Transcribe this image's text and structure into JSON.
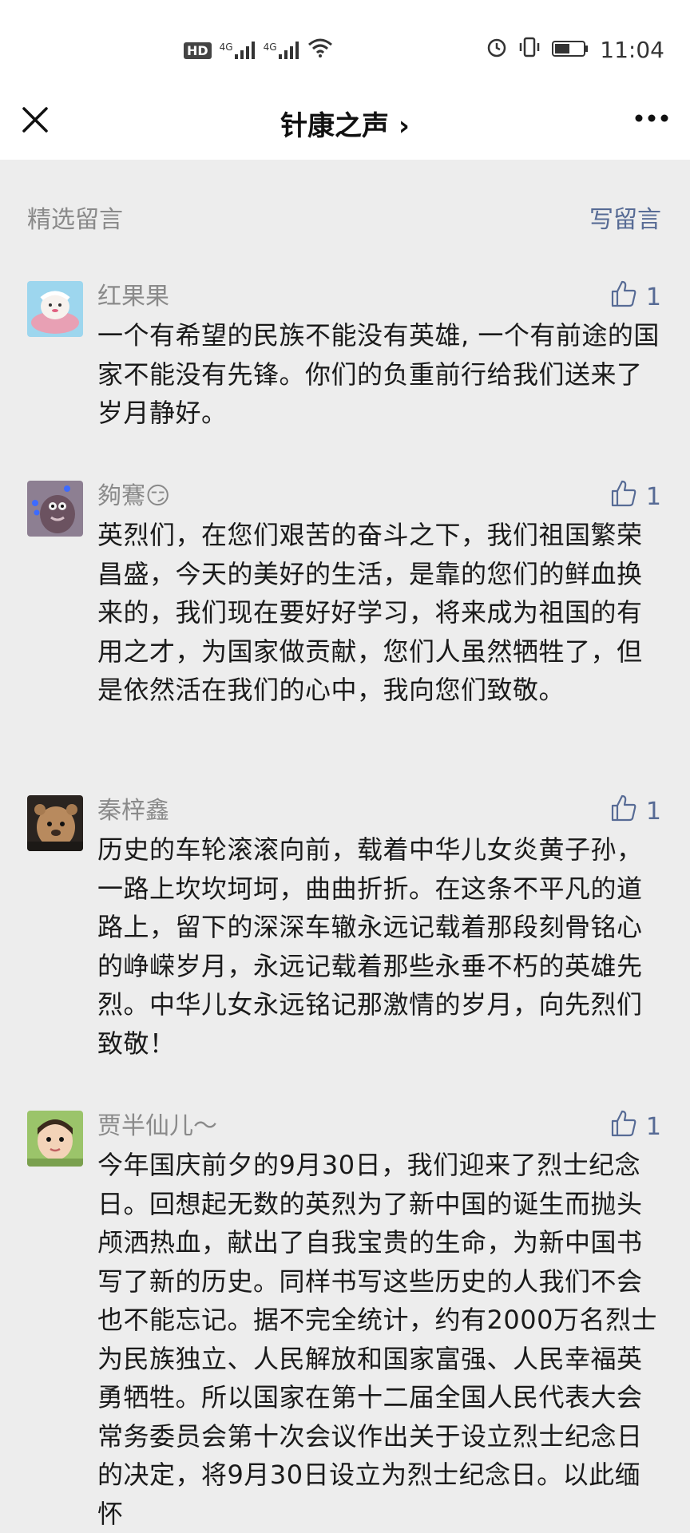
{
  "status_bar": {
    "hd": "HD",
    "sim1": "4G",
    "sim2": "4G",
    "time": "11:04"
  },
  "nav": {
    "title": "针康之声 ›",
    "close_icon": "close-icon",
    "more_icon": "more-icon"
  },
  "section": {
    "label": "精选留言",
    "write": "写留言"
  },
  "comments": [
    {
      "author": "红果果",
      "likes": "1",
      "text": "一个有希望的民族不能没有英雄, 一个有前途的国家不能没有先锋。你们的负重前行给我们送来了岁月静好。"
    },
    {
      "author": "夠鶱😏",
      "likes": "1",
      "text": "英烈们，在您们艰苦的奋斗之下，我们祖国繁荣昌盛，今天的美好的生活，是靠的您们的鲜血换来的，我们现在要好好学习，将来成为祖国的有用之才，为国家做贡献，您们人虽然牺牲了，但是依然活在我们的心中，我向您们致敬。"
    },
    {
      "author": "秦梓鑫",
      "likes": "1",
      "text": "历史的车轮滚滚向前，载着中华儿女炎黄子孙，一路上坎坎坷坷，曲曲折折。在这条不平凡的道路上，留下的深深车辙永远记载着那段刻骨铭心的峥嵘岁月，永远记载着那些永垂不朽的英雄先烈。中华儿女永远铭记那激情的岁月，向先烈们致敬！"
    },
    {
      "author": "贾半仙儿～",
      "likes": "1",
      "text": "今年国庆前夕的9月30日，我们迎来了烈士纪念日。回想起无数的英烈为了新中国的诞生而抛头颅洒热血，献出了自我宝贵的生命，为新中国书写了新的历史。同样书写这些历史的人我们不会也不能忘记。据不完全统计，约有2000万名烈士为民族独立、人民解放和国家富强、人民幸福英勇牺牲。所以国家在第十二届全国人民代表大会常务委员会第十次会议作出关于设立烈士纪念日的决定，将9月30日设立为烈士纪念日。以此缅怀"
    }
  ],
  "colors": {
    "link": "#576b95",
    "meta": "#8a8a8a",
    "background": "#ededed"
  }
}
